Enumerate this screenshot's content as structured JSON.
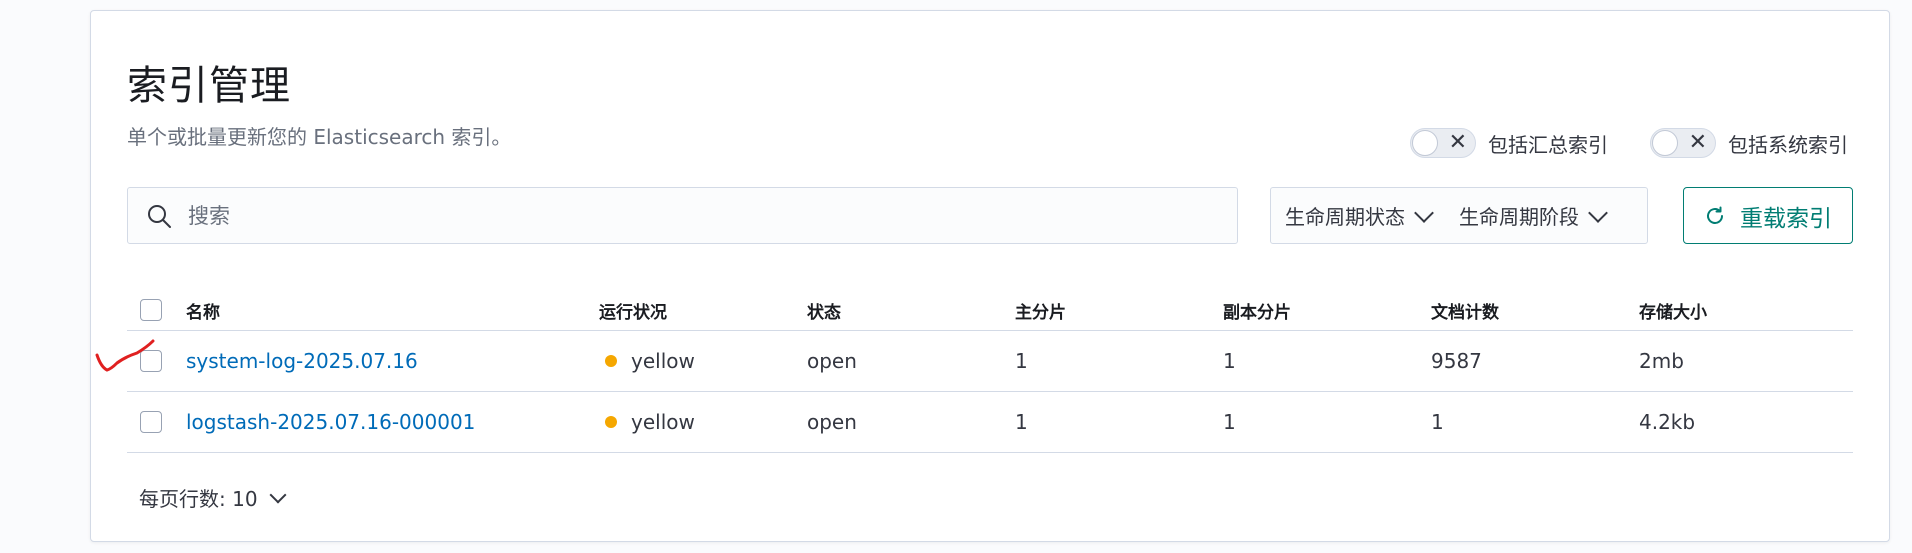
{
  "page": {
    "title": "索引管理",
    "subtitle": "单个或批量更新您的 Elasticsearch 索引。"
  },
  "toggles": [
    {
      "label": "包括汇总索引",
      "on": false
    },
    {
      "label": "包括系统索引",
      "on": false
    }
  ],
  "search": {
    "placeholder": "搜索",
    "value": ""
  },
  "filters": [
    "生命周期状态",
    "生命周期阶段"
  ],
  "reload_button": "重载索引",
  "table": {
    "columns": [
      "名称",
      "运行状况",
      "状态",
      "主分片",
      "副本分片",
      "文档计数",
      "存储大小"
    ],
    "rows": [
      {
        "name": "system-log-2025.07.16",
        "health": "yellow",
        "status": "open",
        "primary": "1",
        "replica": "1",
        "docs": "9587",
        "size": "2mb"
      },
      {
        "name": "logstash-2025.07.16-000001",
        "health": "yellow",
        "status": "open",
        "primary": "1",
        "replica": "1",
        "docs": "1",
        "size": "4.2kb"
      }
    ]
  },
  "pager": {
    "label": "每页行数: 10"
  },
  "colors": {
    "accent": "#017d73",
    "link": "#006bb8",
    "health_yellow": "#f5a700",
    "annotation": "#e02020"
  },
  "icons": {
    "search": "search-icon",
    "refresh": "refresh-icon",
    "close": "close-icon",
    "chevron": "chevron-down-icon"
  }
}
